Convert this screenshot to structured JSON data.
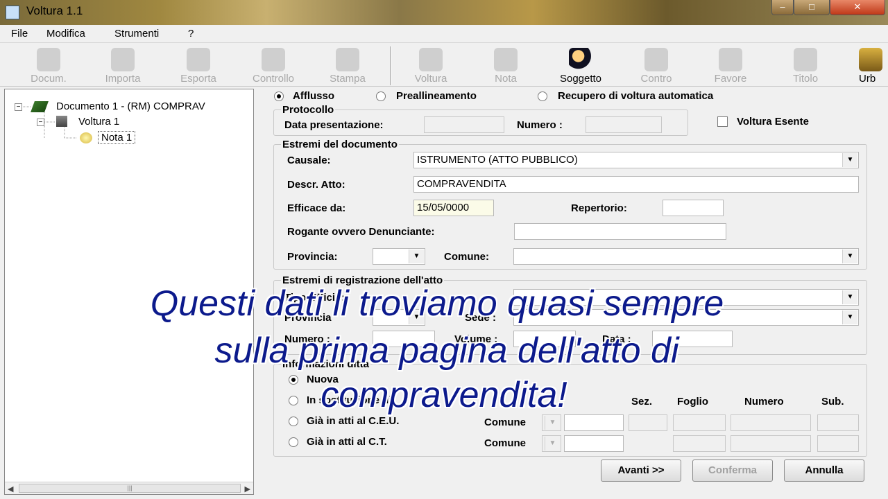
{
  "window": {
    "title": "Voltura 1.1"
  },
  "menu": [
    "File",
    "Modifica",
    "Strumenti",
    "?"
  ],
  "toolbar": {
    "docum": "Docum.",
    "importa": "Importa",
    "esporta": "Esporta",
    "controllo": "Controllo",
    "stampa": "Stampa",
    "voltura": "Voltura",
    "nota": "Nota",
    "soggetto": "Soggetto",
    "contro": "Contro",
    "favore": "Favore",
    "titolo": "Titolo",
    "urb": "Urb"
  },
  "tree": {
    "documento": "Documento  1 - (RM) COMPRAV",
    "voltura": "Voltura  1",
    "nota": "Nota  1"
  },
  "form": {
    "radios": {
      "afflusso": "Afflusso",
      "preallineamento": "Preallineamento",
      "recupero": "Recupero di voltura automatica",
      "selected": "afflusso"
    },
    "protocollo": {
      "title": "Protocollo",
      "data_presentazione_label": "Data presentazione:",
      "data_presentazione_value": "",
      "numero_label": "Numero :",
      "numero_value": ""
    },
    "voltura_esente": {
      "label": "Voltura Esente",
      "checked": false
    },
    "estremi_documento": {
      "title": "Estremi del documento",
      "causale_label": "Causale:",
      "causale_value": "ISTRUMENTO (ATTO PUBBLICO)",
      "descr_label": "Descr. Atto:",
      "descr_value": "COMPRAVENDITA",
      "efficace_label": "Efficace da:",
      "efficace_value": "15/05/0000",
      "repertorio_label": "Repertorio:",
      "repertorio_value": "",
      "rogante_label": "Rogante ovvero Denunciante:",
      "rogante_value": "",
      "provincia_label": "Provincia:",
      "provincia_value": "",
      "comune_label": "Comune:",
      "comune_value": ""
    },
    "estremi_registrazione": {
      "title": "Estremi di registrazione dell'atto",
      "tipo_ufficio_label": "Tipo Ufficio:",
      "provincia_label": "Provincia",
      "sede_label": "Sede :",
      "numero_label": "Numero :",
      "volume_label": "Volume :",
      "data_label": "Data :"
    },
    "informazioni_ditta": {
      "title": "Informazioni ditta",
      "nuova": "Nuova",
      "in_sostituzione": "In sostituzione di",
      "gia_ceu": "Già in atti al C.E.U.",
      "gia_ct": "Già in atti al C.T.",
      "comune_label": "Comune",
      "sez_label": "Sez.",
      "foglio_label": "Foglio",
      "numero_label": "Numero",
      "sub_label": "Sub.",
      "selected": "nuova"
    },
    "buttons": {
      "avanti": "Avanti >>",
      "conferma": "Conferma",
      "annulla": "Annulla"
    }
  },
  "overlay_caption": {
    "line1": "Questi dati li troviamo quasi sempre",
    "line2": "sulla prima pagina dell'atto di",
    "line3": "compravendita!"
  }
}
